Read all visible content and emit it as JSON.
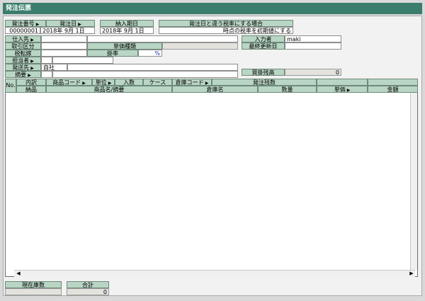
{
  "window": {
    "title": "発注伝票"
  },
  "header": {
    "order_no_label": "発注番号",
    "order_date_label": "発注日",
    "due_date_label": "納入期日",
    "tax_label": "発注日と違う税率にする場合",
    "order_no": "00000001",
    "order_date": "2018年 9月 1日",
    "due_date": "2018年 9月 1日",
    "tax_note": "時点の税率を初期値にする"
  },
  "form": {
    "supplier_label": "仕入先",
    "deal_type_label": "取引区分",
    "price_type_label": "単価種類",
    "tax_transfer_label": "税転嫁",
    "rate_label": "掛率",
    "rate_value": "%",
    "staff_label": "担当者",
    "ship_to_label": "発送先",
    "ship_to_value": "自社",
    "memo_label": "摘要",
    "entered_by_label": "入力者",
    "entered_by_value": "maki",
    "last_updated_label": "最終更新日",
    "payable_label": "買掛残高",
    "payable_value": "0"
  },
  "grid": {
    "h_no": "No.",
    "h_detail": "内訳",
    "h_product_code": "商品コード",
    "h_unit": "単位",
    "h_qty_per": "入数",
    "h_case": "ケース",
    "h_wh_code": "倉庫コード",
    "h_order_rem": "発注残数",
    "h_delivery": "納品",
    "h_product_name": "商品名/摘要",
    "h_wh_name": "倉庫名",
    "h_quantity": "数量",
    "h_price": "単価",
    "h_amount": "金額"
  },
  "footer": {
    "stock_label": "現在庫数",
    "total_label": "合計",
    "total_value": "0"
  }
}
